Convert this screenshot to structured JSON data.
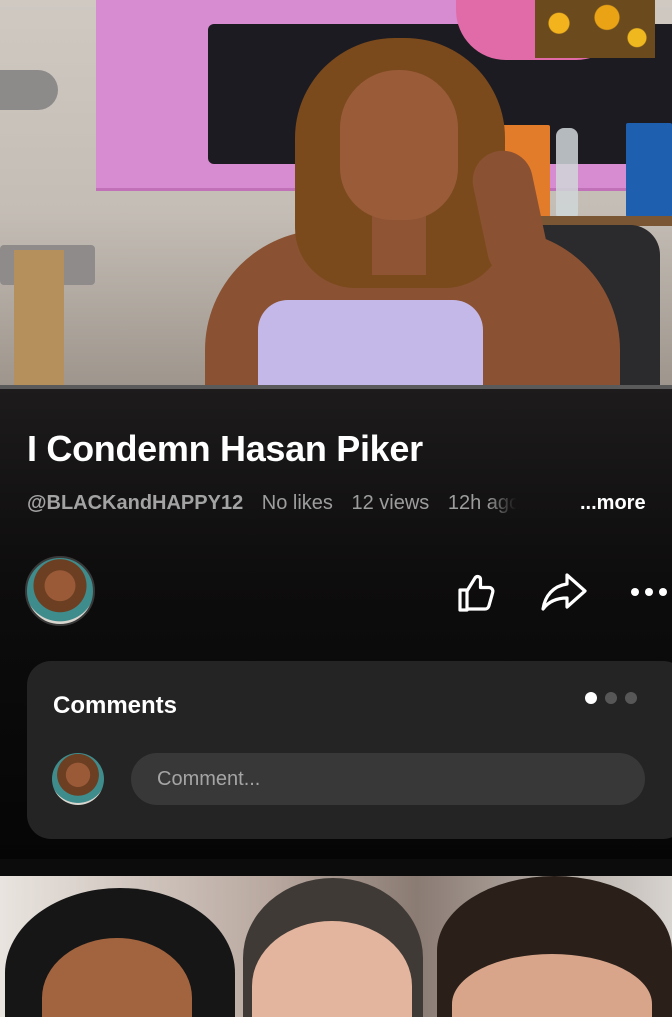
{
  "video": {
    "title": "I Condemn Hasan Piker",
    "channel_handle": "@BLACKandHAPPY12",
    "likes": "No likes",
    "views": "12 views",
    "age": "12h ago",
    "more_label": "...more",
    "progress": 0
  },
  "actions": {
    "like_icon": "thumbs-up-icon",
    "share_icon": "share-arrow-icon",
    "menu_icon": "more-horizontal-icon"
  },
  "comments": {
    "title": "Comments",
    "input_placeholder": "Comment...",
    "page_dots": 3,
    "active_dot": 0
  },
  "colors": {
    "background": "#0c0c0c",
    "card": "#242424",
    "input": "#383838",
    "meta_text": "#9d9d9d"
  }
}
